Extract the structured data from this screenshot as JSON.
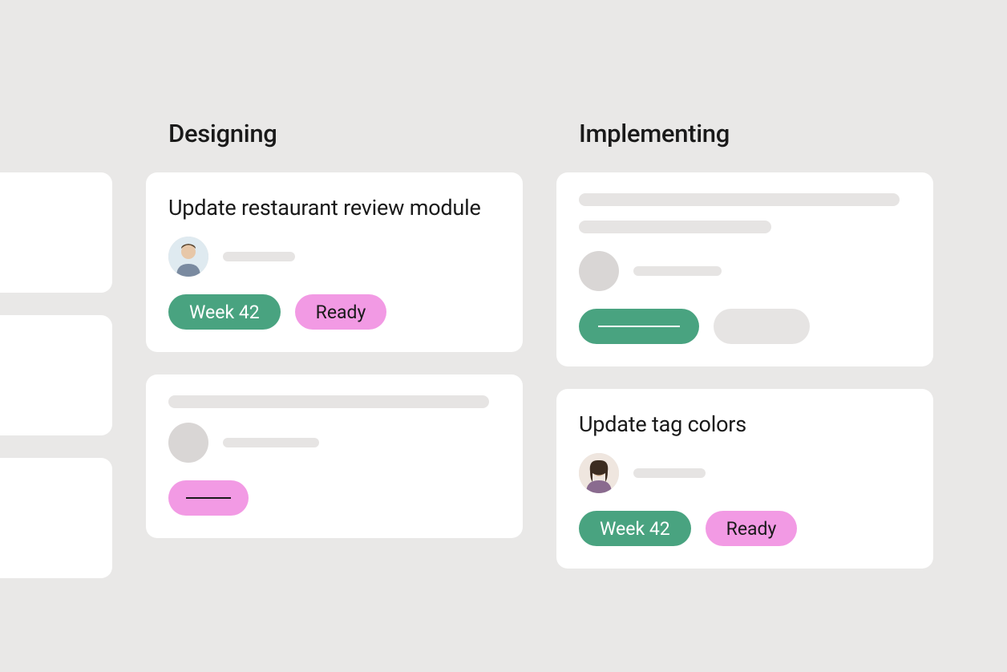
{
  "columns": [
    {
      "title": "Designing",
      "cards": [
        {
          "title": "Update restaurant review module",
          "week_badge": "Week 42",
          "status_badge": "Ready"
        }
      ]
    },
    {
      "title": "Implementing",
      "cards": [
        {
          "title": "Update tag colors",
          "week_badge": "Week 42",
          "status_badge": "Ready"
        }
      ]
    }
  ],
  "colors": {
    "green": "#49a380",
    "pink": "#f29ae4",
    "background": "#e9e8e7"
  }
}
